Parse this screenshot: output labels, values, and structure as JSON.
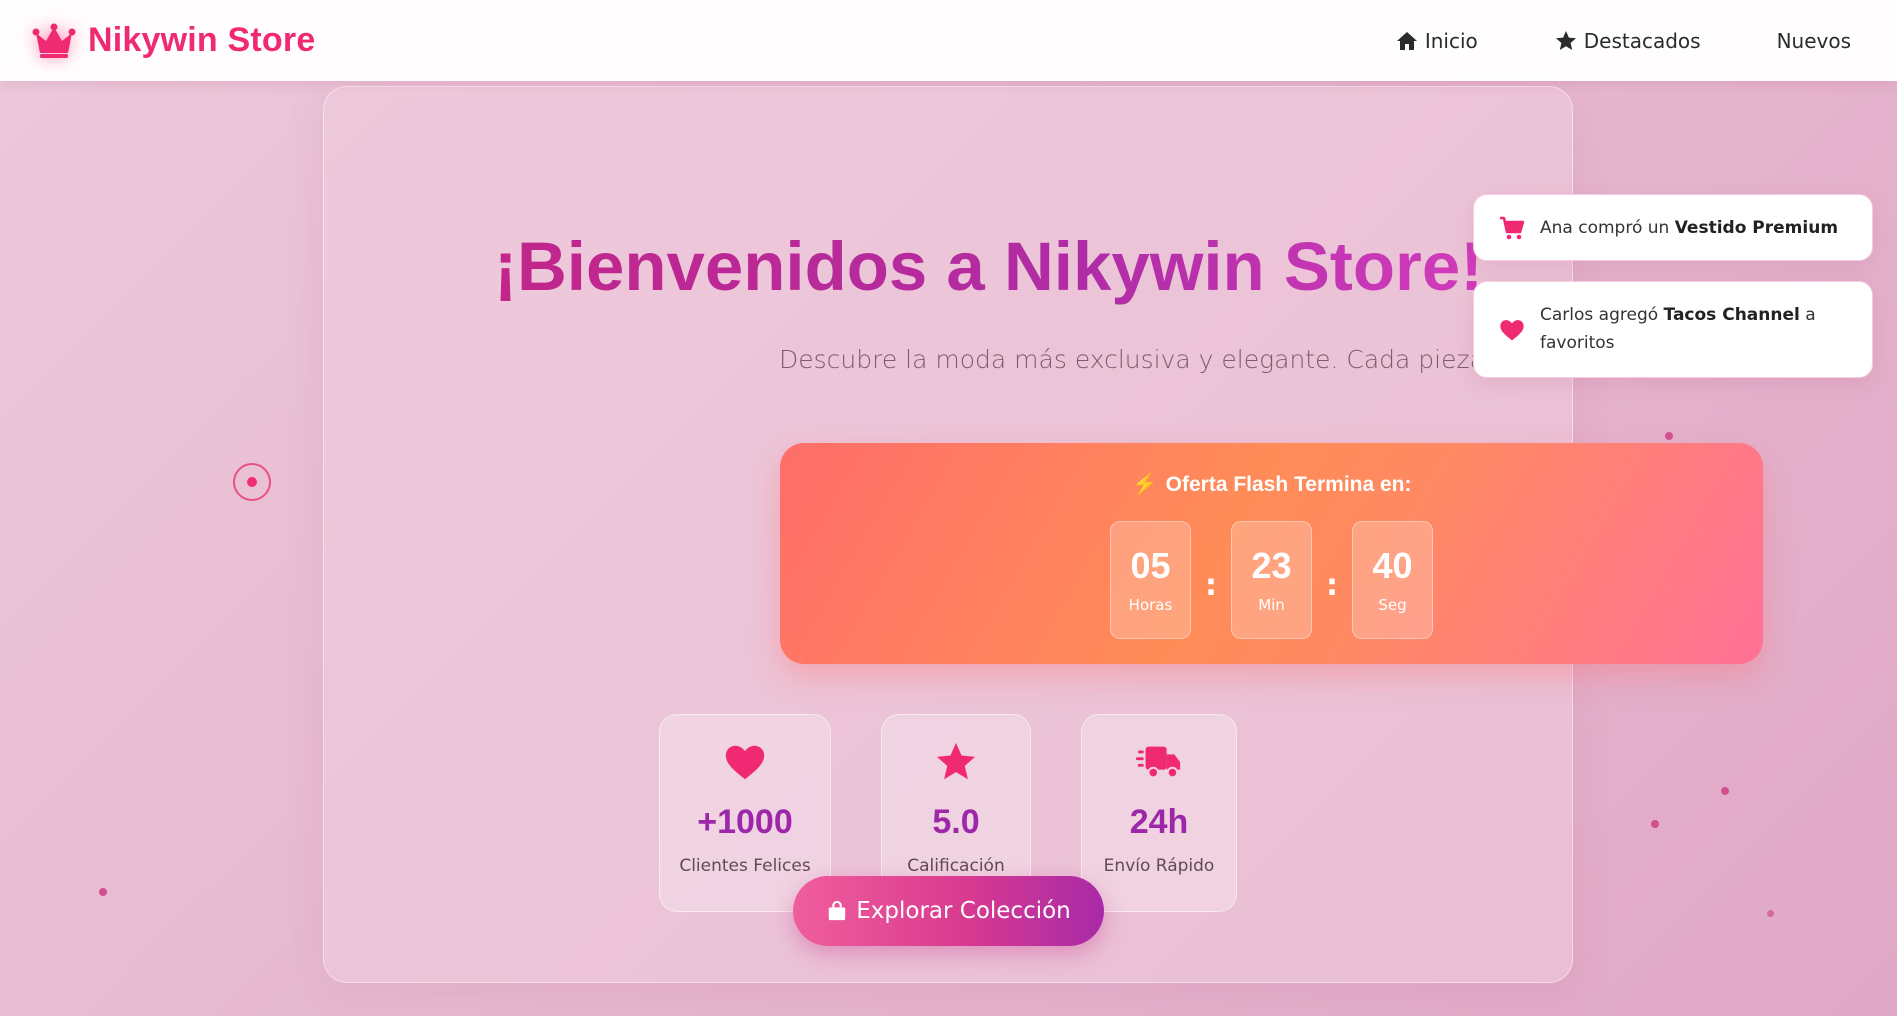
{
  "header": {
    "brand_name": "Nikywin Store",
    "nav": [
      {
        "label": "Inicio",
        "icon": "home-icon"
      },
      {
        "label": "Destacados",
        "icon": "star-icon"
      },
      {
        "label": "Nuevos"
      }
    ]
  },
  "hero": {
    "title": "¡Bienvenidos a Nikywin Store!",
    "subtitle": "Descubre la moda más exclusiva y elegante. Cada pieza cuenta una historia única."
  },
  "flash": {
    "title": "Oferta Flash Termina en:",
    "icon": "bolt-icon",
    "hours": "05",
    "hours_label": "Horas",
    "minutes": "23",
    "minutes_label": "Min",
    "seconds": "40",
    "seconds_label": "Seg",
    "separator": ":"
  },
  "stats": [
    {
      "icon": "heart-icon",
      "value": "+1000",
      "label": "Clientes Felices"
    },
    {
      "icon": "star-icon",
      "value": "5.0",
      "label": "Calificación"
    },
    {
      "icon": "truck-icon",
      "value": "24h",
      "label": "Envío Rápido"
    }
  ],
  "cta": {
    "label": "Explorar Colección",
    "icon": "shopping-bag-icon"
  },
  "notifications": [
    {
      "icon": "cart-icon",
      "prefix": "Ana compró un ",
      "item": "Vestido Premium",
      "suffix": ""
    },
    {
      "icon": "heart-icon",
      "prefix": "Carlos agregó ",
      "item": "Tacos Channel",
      "suffix": " a favoritos"
    }
  ],
  "colors": {
    "brand": "#f02a72",
    "accent_purple": "#9c27a8",
    "flash_start": "#ff6e6a",
    "flash_end": "#ff7196",
    "background": "#e6b8cf"
  }
}
